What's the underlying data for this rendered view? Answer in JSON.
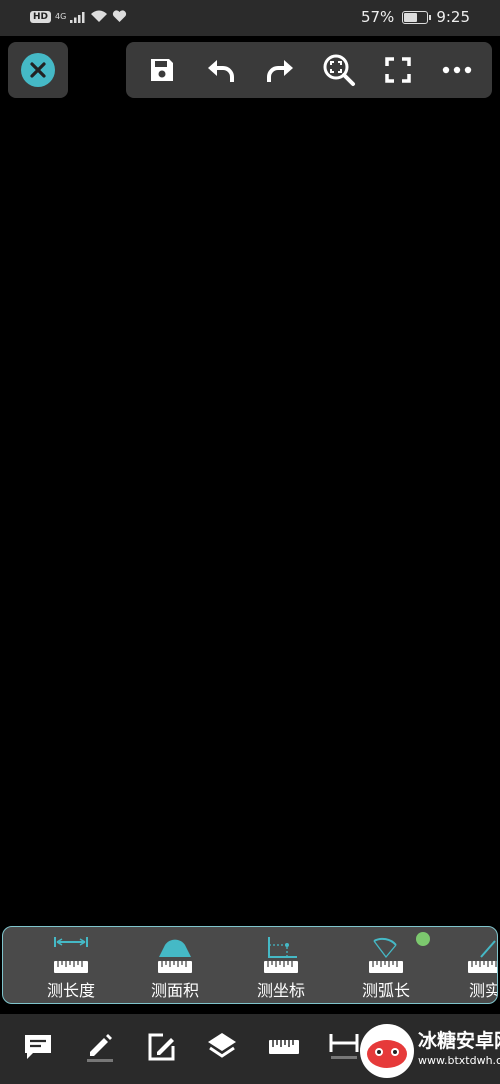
{
  "status_bar": {
    "hd": "HD",
    "network": "4G",
    "battery_text": "57%",
    "battery_level": 0.57,
    "time": "9:25"
  },
  "top_toolbar": {
    "icons": [
      "save-icon",
      "undo-icon",
      "redo-icon",
      "zoom-fit-icon",
      "fullscreen-icon",
      "more-icon"
    ]
  },
  "measure_tools": [
    {
      "label": "测长度",
      "icon": "measure-length-icon"
    },
    {
      "label": "测面积",
      "icon": "measure-area-icon"
    },
    {
      "label": "测坐标",
      "icon": "measure-coordinate-icon"
    },
    {
      "label": "测弧长",
      "icon": "measure-arc-icon"
    },
    {
      "label": "测实",
      "icon": "measure-more-icon"
    }
  ],
  "bottom_toolbar": {
    "icons": [
      "comment-icon",
      "pencil-icon",
      "edit-box-icon",
      "layers-icon",
      "ruler-icon",
      "dimension-icon"
    ]
  },
  "watermark": {
    "title": "冰糖安卓网",
    "url": "www.btxtdwh.com"
  },
  "colors": {
    "accent": "#45b9c6",
    "panel": "#3a3a3a",
    "badge": "#7cc86e"
  }
}
